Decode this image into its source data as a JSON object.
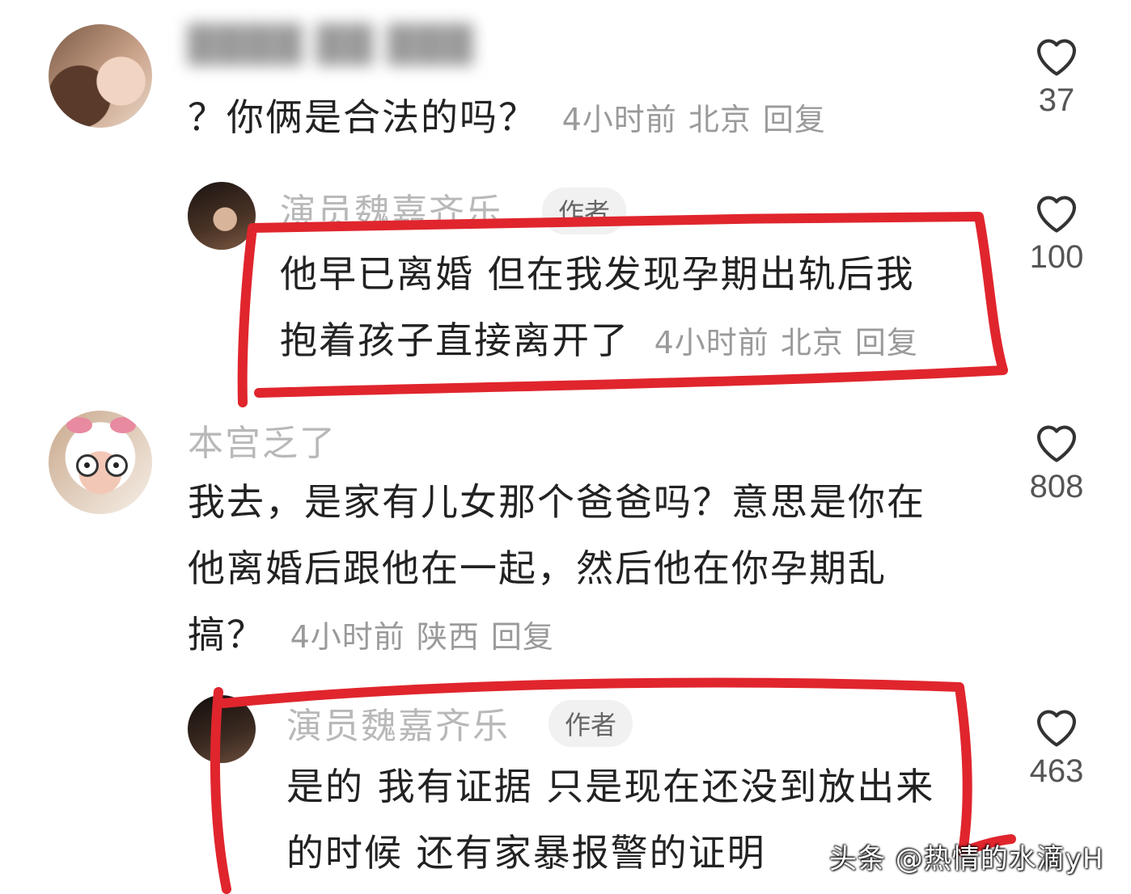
{
  "comments": [
    {
      "username": "",
      "text_lines": [
        "？你俩是合法的吗？"
      ],
      "time": "4小时前",
      "location": "北京",
      "reply": "回复",
      "likes": "37"
    },
    {
      "username": "演员魏嘉齐乐",
      "badge": "作者",
      "text_lines": [
        "他早已离婚 但在我发现孕期出轨后我",
        "抱着孩子直接离开了"
      ],
      "time": "4小时前",
      "location": "北京",
      "reply": "回复",
      "likes": "100"
    },
    {
      "username": "本宫乏了",
      "text_lines": [
        "我去，是家有儿女那个爸爸吗？意思是你在",
        "他离婚后跟他在一起，然后他在你孕期乱",
        "搞？"
      ],
      "time": "4小时前",
      "location": "陕西",
      "reply": "回复",
      "likes": "808"
    },
    {
      "username": "演员魏嘉齐乐",
      "badge": "作者",
      "text_lines": [
        "是的 我有证据 只是现在还没到放出来",
        "的时候 还有家暴报警的证明"
      ],
      "likes": "463"
    }
  ],
  "watermark": "头条 @热情的水滴yH",
  "icons": {
    "like": "heart-outline-icon",
    "annotation_color": "#e0252d"
  }
}
